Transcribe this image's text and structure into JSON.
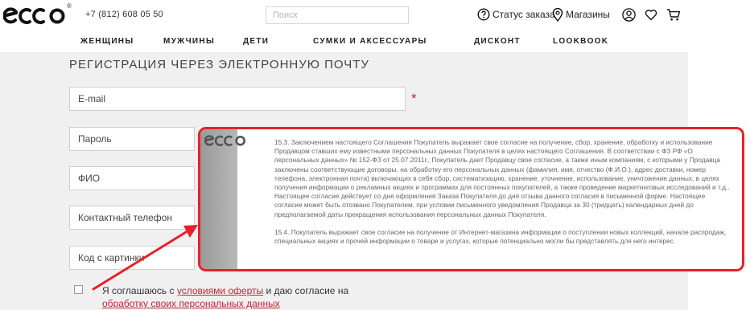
{
  "header": {
    "registered_mark": "®",
    "phone": "+7 (812) 608 05 50",
    "search_placeholder": "Поиск",
    "order_status": "Статус заказа",
    "stores": "Магазины"
  },
  "nav": {
    "items": [
      "ЖЕНЩИНЫ",
      "МУЖЧИНЫ",
      "ДЕТИ",
      "СУМКИ И АКСЕССУАРЫ",
      "ДИСКОНТ",
      "LOOKBOOK"
    ]
  },
  "form": {
    "title": "РЕГИСТРАЦИЯ ЧЕРЕЗ ЭЛЕКТРОННУЮ ПОЧТУ",
    "email_placeholder": "E-mail",
    "required_mark": "*",
    "password_placeholder": "Пароль",
    "fio_placeholder": "ФИО",
    "phone_placeholder": "Контактный телефон",
    "captcha_placeholder": "Код с картинки",
    "agree_text_1": "Я соглашаюсь с ",
    "agree_link_1": "условиями оферты",
    "agree_text_2": " и даю согласие на",
    "agree_link_2": "обработку своих персональных данных"
  },
  "callout": {
    "paragraph_1": "15.3. Заключением настоящего Соглашения Покупатель выражает свое согласие на получение, сбор, хранение, обработку и использование Продавцом ставших ему известными персональных данных Покупателя в целях настоящего Соглашения. В соответствии с ФЗ РФ «О персональных данных» № 152-ФЗ от 25.07.2011г., Покупатель дает Продавцу свое согласие, а также иным компаниям, с которыми у Продавца заключены соответствующие договоры, на обработку его персональных данных (фамилия, имя, отчество (Ф.И.О.), адрес доставки, номер телефона, электронная почта) включающих в себя сбор, систематизацию, хранение, уточнение, использование, уничтожение данных, в целях получения информации о рекламных акциях и программах для постоянных покупателей, а также проведение маркетинговых исследований и т.д.. Настоящее согласие действует со дня оформления Заказа Покупателя до дня отзыва данного согласия в письменной форме. Настоящее согласие может быть отозвано Покупателем, при условии письменного уведомления Продавца за 30 (тридцать) календарных дней до предполагаемой даты прекращения использования персональных данных Покупателя.",
    "paragraph_2": "15.4. Покупатель выражает свое согласие на получение от Интернет-магазина информации о поступлении новых коллекций, начале распродаж, специальных акциях и прочей информации о товаре и услугах, которые потенциально могли бы представлять для него интерес."
  },
  "colors": {
    "accent_red": "#c0263a",
    "callout_border": "#e8202a",
    "page_bg": "#f0f0f0"
  },
  "icons": {
    "logo": "ecco-logo",
    "order_status": "question-circle-icon",
    "stores": "location-pin-icon",
    "account": "user-icon",
    "wishlist": "heart-icon",
    "cart": "cart-icon"
  }
}
